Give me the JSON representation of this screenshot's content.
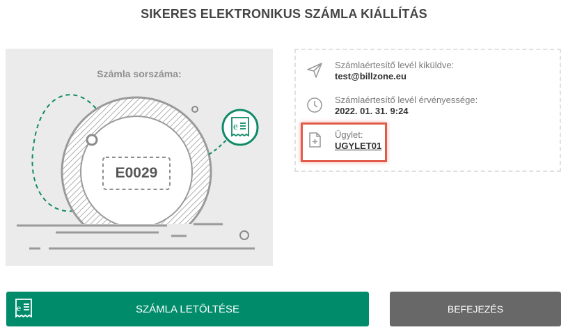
{
  "page": {
    "title": "SIKERES ELEKTRONIKUS SZÁMLA KIÁLLÍTÁS"
  },
  "illustration": {
    "label": "Számla sorszáma:",
    "serial_number": "E0029",
    "badge_icon": "e-invoice-receipt-icon"
  },
  "info": {
    "notification": {
      "icon": "paper-plane-icon",
      "label": "Számlaértesítő levél kiküldve:",
      "value": "test@billzone.eu"
    },
    "validity": {
      "icon": "clock-icon",
      "label": "Számlaértesítő levél érvényessége:",
      "value": "2022. 01. 31. 9:24"
    },
    "deal": {
      "icon": "document-plus-icon",
      "label": "Ügylet:",
      "value": "UGYLET01"
    }
  },
  "buttons": {
    "download_label": "SZÁMLA LETÖLTÉSE",
    "download_icon": "e-invoice-receipt-icon",
    "finish_label": "BEFEJEZÉS"
  },
  "colors": {
    "accent": "#008c6b",
    "finish_button": "#686868",
    "highlight": "#e25a4a",
    "card_background": "#ebebeb"
  }
}
